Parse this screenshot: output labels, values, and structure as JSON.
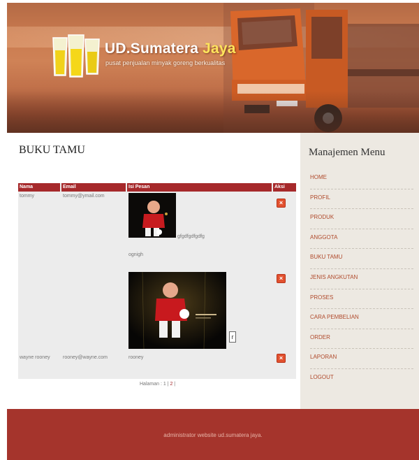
{
  "header": {
    "site_name_main": "UD.Sumatera ",
    "site_name_accent": "Jaya",
    "tagline": "pusat penjualan minyak goreng berkualitas"
  },
  "main": {
    "page_title": "BUKU TAMU",
    "table": {
      "columns": [
        "Nama",
        "Email",
        "Isi Pesan",
        "Aksi"
      ],
      "rows": [
        {
          "name": "tommy",
          "email": "tommy@ymail.com",
          "message_text": "gfgdfgdfgdfg",
          "message_text2": "ognigh",
          "action_label": "×"
        },
        {
          "name": "",
          "email": "",
          "message_text": "",
          "action_label": "×"
        },
        {
          "name": "wayne rooney",
          "email": "rooney@wayne.com",
          "message_text": "rooney",
          "action_label": "×"
        }
      ],
      "photo_tag_letter": "r"
    },
    "pagination": {
      "label": "Halaman : 1 | ",
      "page2": "2",
      "suffix": " |"
    }
  },
  "sidebar": {
    "title": "Manajemen Menu",
    "items": [
      "HOME",
      "PROFIL",
      "PRODUK",
      "ANGGOTA",
      "BUKU TAMU",
      "JENIS ANGKUTAN",
      "PROSES",
      "CARA PEMBELIAN",
      "ORDER",
      "LAPORAN",
      "LOGOUT"
    ]
  },
  "footer": {
    "text": "administrator website ud.sumatera jaya."
  },
  "colors": {
    "brand_red": "#a6292b",
    "footer_red": "#a5342c",
    "delete_orange": "#e2512f",
    "sidebar_bg": "#ede9e2"
  }
}
